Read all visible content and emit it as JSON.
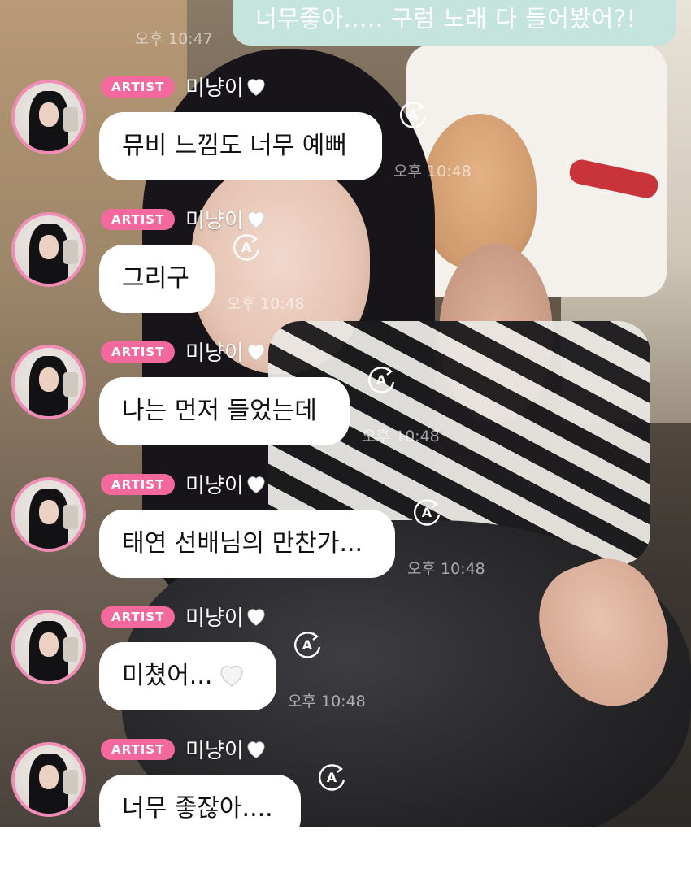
{
  "top_message": {
    "text": "너무좋아..... 구럼 노래 다 들어봤어?!",
    "time": "오후 10:47"
  },
  "colors": {
    "badge": "#f4699d",
    "avatar_ring": "#f08db6",
    "sent_bubble": "#c5e4de",
    "received_bubble": "#ffffff"
  },
  "messages": [
    {
      "badge": "ARTIST",
      "sender": "미냥이",
      "text": "뮤비 느낌도 너무 예뻐",
      "time": "오후 10:48",
      "icon": "auto-translate-icon"
    },
    {
      "badge": "ARTIST",
      "sender": "미냥이",
      "text": "그리구",
      "time": "오후 10:48",
      "icon": "auto-translate-icon"
    },
    {
      "badge": "ARTIST",
      "sender": "미냥이",
      "text": "나는 먼저 들었는데",
      "time": "오후 10:48",
      "icon": "auto-translate-icon"
    },
    {
      "badge": "ARTIST",
      "sender": "미냥이",
      "text": "태연 선배님의 만찬가...",
      "time": "오후 10:48",
      "icon": "auto-translate-icon"
    },
    {
      "badge": "ARTIST",
      "sender": "미냥이",
      "text": "미쳤어...",
      "time": "오후 10:48",
      "icon": "auto-translate-icon"
    },
    {
      "badge": "ARTIST",
      "sender": "미냥이",
      "text": "너무 좋잖아....",
      "time": "",
      "icon": "auto-translate-icon"
    }
  ]
}
